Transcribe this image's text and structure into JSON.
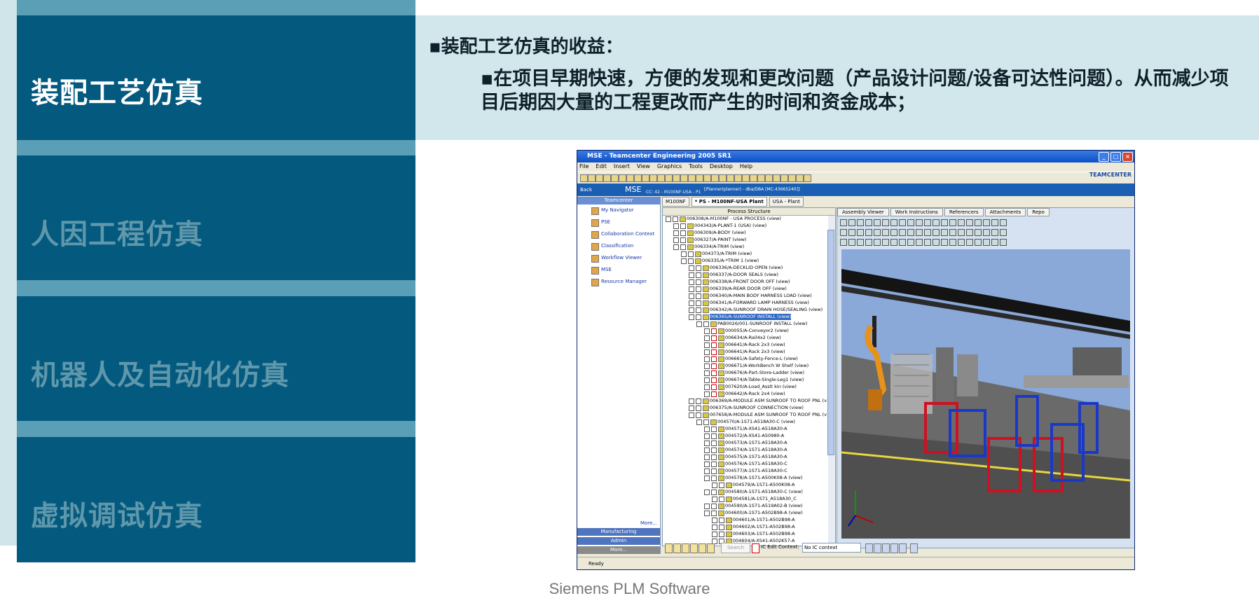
{
  "nav": {
    "items": [
      "装配工艺仿真",
      "人因工程仿真",
      "机器人及自动化仿真",
      "虚拟调试仿真"
    ],
    "active_index": 0
  },
  "header": {
    "title": "▪装配工艺仿真的收益：",
    "body": "▪在项目早期快速，方便的发现和更改问题（产品设计问题/设备可达性问题）。从而减少项目后期因大量的工程更改而产生的时间和资金成本；"
  },
  "caption": "Siemens PLM Software",
  "tc": {
    "title": "MSE - Teamcenter Engineering 2005 SR1",
    "menu": [
      "File",
      "Edit",
      "Insert",
      "View",
      "Graphics",
      "Tools",
      "Desktop",
      "Help"
    ],
    "logo": "TEAMCENTER",
    "appbar": {
      "back": "Back",
      "app": "MSE",
      "context": "CC: 42 - M100NF-USA - P1",
      "planner": "{Planner(planner) - dba/DBA [MC-43665240]}"
    },
    "nav_header": "Teamcenter",
    "nav_items": [
      "My Navigator",
      "PSE",
      "Collaboration Context",
      "Classification",
      "Workflow Viewer",
      "MSE",
      "Resource Manager"
    ],
    "nav_more": "More...",
    "nav_footer": [
      "Manufacturing",
      "Admin",
      "More..."
    ],
    "tabs": [
      "M100NF",
      "* PS - M100NF-USA Plant",
      "USA - Plant"
    ],
    "tree_header": "Process Structure",
    "tree": [
      "006308/A-M100NF - USA PROCESS (view)",
      "004343/A-PLANT-1 (USA) (view)",
      "006309/A-BODY (view)",
      "006327/A-PAINT (view)",
      "006334/A-TRIM (view)",
      "004373/A-TRIM (view)",
      "006335/A-*TRIM 1 (view)",
      "006336/A-DECKLID OPEN (view)",
      "006337/A-DOOR SEALS (view)",
      "006338/A-FRONT DOOR OFF (view)",
      "006339/A-REAR DOOR OFF (view)",
      "006340/A-MAIN BODY HARNESS LOAD (view)",
      "006341/A-FORWARD LAMP HARNESS (view)",
      "006342/A-SUNROOF DRAIN HOSE/SEALING (view)",
      "006365/A-SUNROOF INSTALL (view)",
      "PAB0026/001-SUNROOF INSTALL (view)",
      "000055/A-Conveyor2 (view)",
      "006634/A-Rail4x2 (view)",
      "006641/A-Rack 2x3 (view)",
      "006641/A-Rack 2x3 (view)",
      "006661/A-Safety-Fence-L (view)",
      "006671/A-WorkBench W Shelf (view)",
      "006676/A-Part-Store-Ladder (view)",
      "006674/A-Table-Single-Leg1 (view)",
      "007620/A-Load_Asslt kin (view)",
      "006642/A-Rack 2x4 (view)",
      "006369/A-MODULE ASM SUNROOF TO ROOF PNL (view)",
      "006375/A-SUNROOF CONNECTION (view)",
      "007658/A-MODULE ASM SUNROOF TO ROOF PNL (view)",
      "004570/A-1S71-A518A30-C (view)",
      "004571/A-XS41-A518A30-A",
      "004572/A-XS41-A50980-A",
      "004573/A-1S71-A518A30-A",
      "004574/A-1S71-A518A30-A",
      "004575/A-1S71-A518A30-A",
      "004576/A-1S71-A518A30-C",
      "004577/A-1S71-A518A30-C",
      "004578/A-1S71-A500K08-A (view)",
      "004579/A-1S71-A500K08-A",
      "004580/A-1S71-A518A30-C (view)",
      "004581/A-1S71_A518A30_C",
      "004590/A-1S71-A519A02-B (view)",
      "004600/A-1S71-A502B98-A (view)",
      "004601/A-1S71-A502B98-A",
      "004602/A-1S71-A502B98-A",
      "004603/A-1S71-A502B98-A",
      "004604/A-XS41-A502K57-A"
    ],
    "selected_row": 14,
    "viewer_tabs": [
      "Assembly Viewer",
      "Work Instructions",
      "Referencers",
      "Attachments",
      "Repo"
    ],
    "search_label": "Search",
    "ic_label": "IC Edit Context:",
    "ic_value": "No IC context",
    "status": "Ready"
  }
}
